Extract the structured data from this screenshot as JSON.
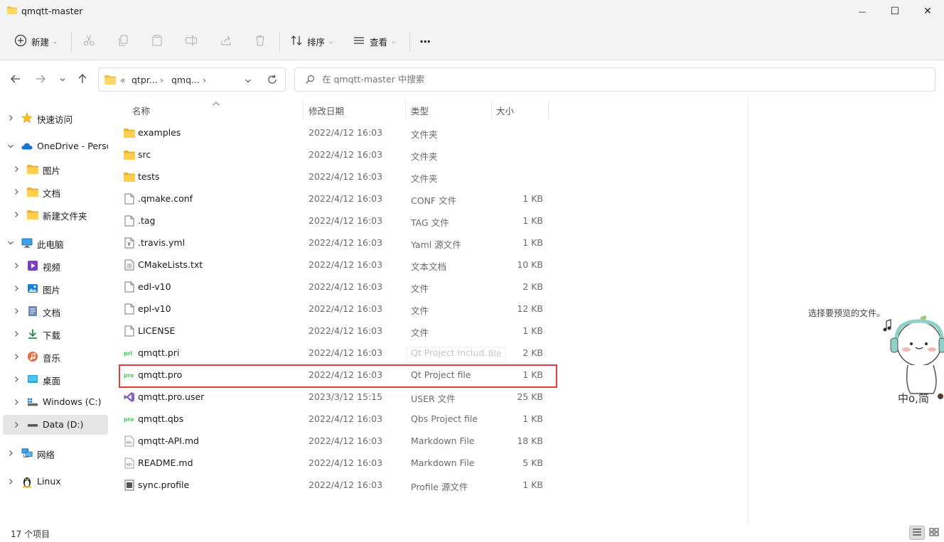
{
  "window": {
    "title": "qmqtt-master",
    "minimize_glyph": "—",
    "maximize_glyph": "☐",
    "close_glyph": "✕"
  },
  "toolbar": {
    "new_label": "新建",
    "sort_label": "排序",
    "view_label": "查看",
    "more_glyph": "···"
  },
  "address": {
    "prefix": "«",
    "segments": [
      "qtpr...",
      "qmq..."
    ],
    "separator": "›"
  },
  "search": {
    "placeholder": "在 qmqtt-master 中搜索"
  },
  "sidebar": {
    "items": [
      {
        "label": "快速访问",
        "icon": "star-icon",
        "expanded": false,
        "level": 0
      },
      {
        "label": "OneDrive - Perso",
        "icon": "cloud-icon",
        "expanded": true,
        "level": 0
      },
      {
        "label": "图片",
        "icon": "folder-icon",
        "expanded": false,
        "level": 1
      },
      {
        "label": "文档",
        "icon": "folder-icon",
        "expanded": false,
        "level": 1
      },
      {
        "label": "新建文件夹",
        "icon": "folder-icon",
        "expanded": false,
        "level": 1
      },
      {
        "label": "此电脑",
        "icon": "monitor-icon",
        "expanded": true,
        "level": 0
      },
      {
        "label": "视频",
        "icon": "video-icon",
        "expanded": false,
        "level": 1
      },
      {
        "label": "图片",
        "icon": "picture-icon",
        "expanded": false,
        "level": 1
      },
      {
        "label": "文档",
        "icon": "document-icon",
        "expanded": false,
        "level": 1
      },
      {
        "label": "下载",
        "icon": "download-icon",
        "expanded": false,
        "level": 1
      },
      {
        "label": "音乐",
        "icon": "music-icon",
        "expanded": false,
        "level": 1
      },
      {
        "label": "桌面",
        "icon": "desktop-icon",
        "expanded": false,
        "level": 1
      },
      {
        "label": "Windows (C:)",
        "icon": "windows-drive-icon",
        "expanded": false,
        "level": 1
      },
      {
        "label": "Data (D:)",
        "icon": "drive-icon",
        "expanded": false,
        "level": 1,
        "selected": true
      },
      {
        "label": "网络",
        "icon": "network-icon",
        "expanded": false,
        "level": 0
      },
      {
        "label": "Linux",
        "icon": "linux-icon",
        "expanded": false,
        "level": 0
      }
    ]
  },
  "columns": {
    "name": "名称",
    "date": "修改日期",
    "type": "类型",
    "size": "大小"
  },
  "files": [
    {
      "name": "examples",
      "date": "2022/4/12 16:03",
      "type": "文件夹",
      "size": "",
      "icon": "folder-icon"
    },
    {
      "name": "src",
      "date": "2022/4/12 16:03",
      "type": "文件夹",
      "size": "",
      "icon": "folder-icon"
    },
    {
      "name": "tests",
      "date": "2022/4/12 16:03",
      "type": "文件夹",
      "size": "",
      "icon": "folder-icon"
    },
    {
      "name": ".qmake.conf",
      "date": "2022/4/12 16:03",
      "type": "CONF 文件",
      "size": "1 KB",
      "icon": "file-icon"
    },
    {
      "name": ".tag",
      "date": "2022/4/12 16:03",
      "type": "TAG 文件",
      "size": "1 KB",
      "icon": "file-icon"
    },
    {
      "name": ".travis.yml",
      "date": "2022/4/12 16:03",
      "type": "Yaml 源文件",
      "size": "1 KB",
      "icon": "yaml-file-icon"
    },
    {
      "name": "CMakeLists.txt",
      "date": "2022/4/12 16:03",
      "type": "文本文档",
      "size": "10 KB",
      "icon": "text-file-icon"
    },
    {
      "name": "edl-v10",
      "date": "2022/4/12 16:03",
      "type": "文件",
      "size": "2 KB",
      "icon": "file-icon"
    },
    {
      "name": "epl-v10",
      "date": "2022/4/12 16:03",
      "type": "文件",
      "size": "12 KB",
      "icon": "file-icon"
    },
    {
      "name": "LICENSE",
      "date": "2022/4/12 16:03",
      "type": "文件",
      "size": "1 KB",
      "icon": "file-icon"
    },
    {
      "name": "qmqtt.pri",
      "date": "2022/4/12 16:03",
      "type": "Qt Project Includ...",
      "size": "2 KB",
      "icon": "qt-pri-icon"
    },
    {
      "name": "qmqtt.pro",
      "date": "2022/4/12 16:03",
      "type": "Qt Project file",
      "size": "1 KB",
      "icon": "qt-pro-icon"
    },
    {
      "name": "qmqtt.pro.user",
      "date": "2023/3/12 15:15",
      "type": "USER 文件",
      "size": "25 KB",
      "icon": "visual-studio-icon"
    },
    {
      "name": "qmqtt.qbs",
      "date": "2022/4/12 16:03",
      "type": "Qbs Project file",
      "size": "1 KB",
      "icon": "qt-pro-icon"
    },
    {
      "name": "qmqtt-API.md",
      "date": "2022/4/12 16:03",
      "type": "Markdown File",
      "size": "18 KB",
      "icon": "markdown-icon"
    },
    {
      "name": "README.md",
      "date": "2022/4/12 16:03",
      "type": "Markdown File",
      "size": "5 KB",
      "icon": "markdown-icon"
    },
    {
      "name": "sync.profile",
      "date": "2022/4/12 16:03",
      "type": "Profile 源文件",
      "size": "1 KB",
      "icon": "profile-file-icon"
    }
  ],
  "tooltip_ghost": "file",
  "preview": {
    "text": "选择要预览的文件。"
  },
  "status": {
    "count": "17 个项目"
  }
}
